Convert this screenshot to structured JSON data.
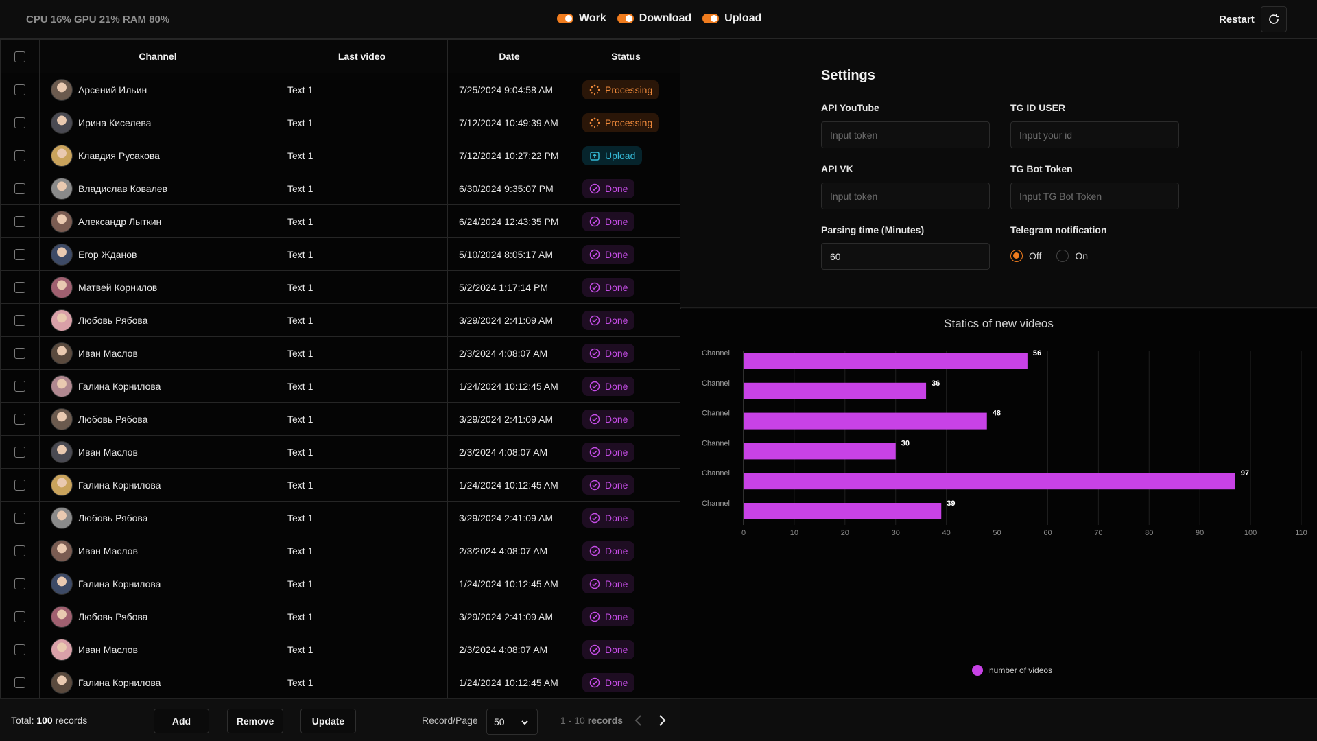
{
  "topbar": {
    "system_stats": "CPU 16% GPU 21% RAM 80%",
    "toggles": [
      {
        "label": "Work",
        "on": true
      },
      {
        "label": "Download",
        "on": true
      },
      {
        "label": "Upload",
        "on": true
      }
    ],
    "restart_label": "Restart"
  },
  "table": {
    "headers": {
      "channel": "Channel",
      "last_video": "Last video",
      "date": "Date",
      "status": "Status"
    },
    "rows": [
      {
        "channel": "Арсений Ильин",
        "last_video": "Text 1",
        "date": "7/25/2024 9:04:58 AM",
        "status": "Processing",
        "status_type": "processing"
      },
      {
        "channel": "Ирина Киселева",
        "last_video": "Text 1",
        "date": "7/12/2024 10:49:39 AM",
        "status": "Processing",
        "status_type": "processing"
      },
      {
        "channel": "Клавдия Русакова",
        "last_video": "Text 1",
        "date": "7/12/2024 10:27:22 PM",
        "status": "Upload",
        "status_type": "upload"
      },
      {
        "channel": "Владислав Ковалев",
        "last_video": "Text 1",
        "date": "6/30/2024 9:35:07 PM",
        "status": "Done",
        "status_type": "done"
      },
      {
        "channel": "Александр Лыткин",
        "last_video": "Text 1",
        "date": "6/24/2024 12:43:35 PM",
        "status": "Done",
        "status_type": "done"
      },
      {
        "channel": "Егор Жданов",
        "last_video": "Text 1",
        "date": "5/10/2024 8:05:17 AM",
        "status": "Done",
        "status_type": "done"
      },
      {
        "channel": "Матвей Корнилов",
        "last_video": "Text 1",
        "date": "5/2/2024 1:17:14 PM",
        "status": "Done",
        "status_type": "done"
      },
      {
        "channel": "Любовь Рябова",
        "last_video": "Text 1",
        "date": "3/29/2024 2:41:09 AM",
        "status": "Done",
        "status_type": "done"
      },
      {
        "channel": "Иван Маслов",
        "last_video": "Text 1",
        "date": "2/3/2024 4:08:07 AM",
        "status": "Done",
        "status_type": "done"
      },
      {
        "channel": "Галина Корнилова",
        "last_video": "Text 1",
        "date": "1/24/2024 10:12:45 AM",
        "status": "Done",
        "status_type": "done"
      },
      {
        "channel": "Любовь Рябова",
        "last_video": "Text 1",
        "date": "3/29/2024 2:41:09 AM",
        "status": "Done",
        "status_type": "done"
      },
      {
        "channel": "Иван Маслов",
        "last_video": "Text 1",
        "date": "2/3/2024 4:08:07 AM",
        "status": "Done",
        "status_type": "done"
      },
      {
        "channel": "Галина Корнилова",
        "last_video": "Text 1",
        "date": "1/24/2024 10:12:45 AM",
        "status": "Done",
        "status_type": "done"
      },
      {
        "channel": "Любовь Рябова",
        "last_video": "Text 1",
        "date": "3/29/2024 2:41:09 AM",
        "status": "Done",
        "status_type": "done"
      },
      {
        "channel": "Иван Маслов",
        "last_video": "Text 1",
        "date": "2/3/2024 4:08:07 AM",
        "status": "Done",
        "status_type": "done"
      },
      {
        "channel": "Галина Корнилова",
        "last_video": "Text 1",
        "date": "1/24/2024 10:12:45 AM",
        "status": "Done",
        "status_type": "done"
      },
      {
        "channel": "Любовь Рябова",
        "last_video": "Text 1",
        "date": "3/29/2024 2:41:09 AM",
        "status": "Done",
        "status_type": "done"
      },
      {
        "channel": "Иван Маслов",
        "last_video": "Text 1",
        "date": "2/3/2024 4:08:07 AM",
        "status": "Done",
        "status_type": "done"
      },
      {
        "channel": "Галина Корнилова",
        "last_video": "Text 1",
        "date": "1/24/2024 10:12:45 AM",
        "status": "Done",
        "status_type": "done"
      }
    ]
  },
  "footer": {
    "total_prefix": "Total:",
    "total_count": "100",
    "total_suffix": "records",
    "add_label": "Add",
    "remove_label": "Remove",
    "update_label": "Update",
    "records_per_page_label": "Record/Page",
    "records_per_page_value": "50",
    "range_text": "1 - 10",
    "range_suffix": "records"
  },
  "settings": {
    "title": "Settings",
    "api_youtube_label": "API YouTube",
    "api_youtube_placeholder": "Input token",
    "tg_id_label": "TG ID USER",
    "tg_id_placeholder": "Input your id",
    "api_vk_label": "API VK",
    "api_vk_placeholder": "Input token",
    "tg_bot_label": "TG Bot Token",
    "tg_bot_placeholder": "Input TG Bot Token",
    "parsing_label": "Parsing time (Minutes)",
    "parsing_value": "60",
    "telegram_label": "Telegram notification",
    "radio_off": "Off",
    "radio_on": "On",
    "selected": "Off"
  },
  "colors": {
    "accent": "#f07c1e",
    "bar": "#c842e6",
    "processing": "#f08a3b",
    "upload": "#35b9d6",
    "done": "#c54de6"
  },
  "chart_data": {
    "type": "bar",
    "orientation": "horizontal",
    "title": "Statics of new videos",
    "categories": [
      "Channel",
      "Channel",
      "Channel",
      "Channel",
      "Channel",
      "Channel"
    ],
    "series": [
      {
        "name": "number of videos",
        "values": [
          56,
          36,
          48,
          30,
          97,
          39
        ]
      }
    ],
    "xlim": [
      0,
      110
    ],
    "xticks": [
      0,
      10,
      20,
      30,
      40,
      50,
      60,
      70,
      80,
      90,
      100,
      110
    ],
    "grid": true,
    "legend": "bottom-center"
  }
}
